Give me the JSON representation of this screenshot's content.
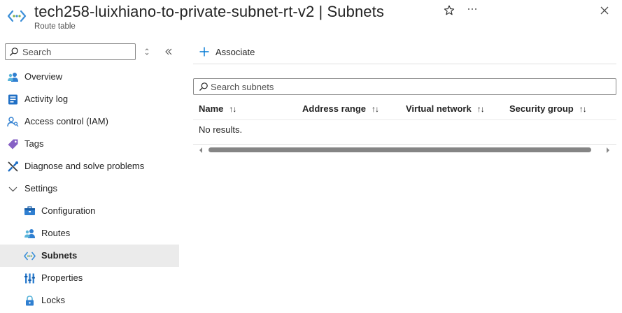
{
  "header": {
    "title": "tech258-luixhiano-to-private-subnet-rt-v2 | Subnets",
    "subtitle": "Route table",
    "resource_icon": "route-table-icon",
    "favorite_icon": "star-icon",
    "more_icon": "ellipsis-icon",
    "close_icon": "close-icon"
  },
  "sidebar": {
    "search_placeholder": "Search",
    "items": [
      {
        "label": "Overview",
        "icon": "overview-icon"
      },
      {
        "label": "Activity log",
        "icon": "activity-log-icon"
      },
      {
        "label": "Access control (IAM)",
        "icon": "access-control-icon"
      },
      {
        "label": "Tags",
        "icon": "tag-icon"
      },
      {
        "label": "Diagnose and solve problems",
        "icon": "wrench-icon"
      },
      {
        "label": "Settings",
        "icon": "chevron-down-icon"
      },
      {
        "label": "Configuration",
        "icon": "configuration-icon"
      },
      {
        "label": "Routes",
        "icon": "routes-icon"
      },
      {
        "label": "Subnets",
        "icon": "subnets-icon",
        "selected": true
      },
      {
        "label": "Properties",
        "icon": "properties-icon"
      },
      {
        "label": "Locks",
        "icon": "lock-icon"
      }
    ]
  },
  "main": {
    "command": {
      "label": "Associate",
      "icon": "plus-icon"
    },
    "filter_placeholder": "Search subnets",
    "columns": [
      "Name",
      "Address range",
      "Virtual network",
      "Security group"
    ],
    "sort_glyph": "↑↓",
    "empty_text": "No results."
  },
  "colors": {
    "accent": "#0078d4",
    "selected_bg": "#ebebeb",
    "text": "#242424"
  }
}
